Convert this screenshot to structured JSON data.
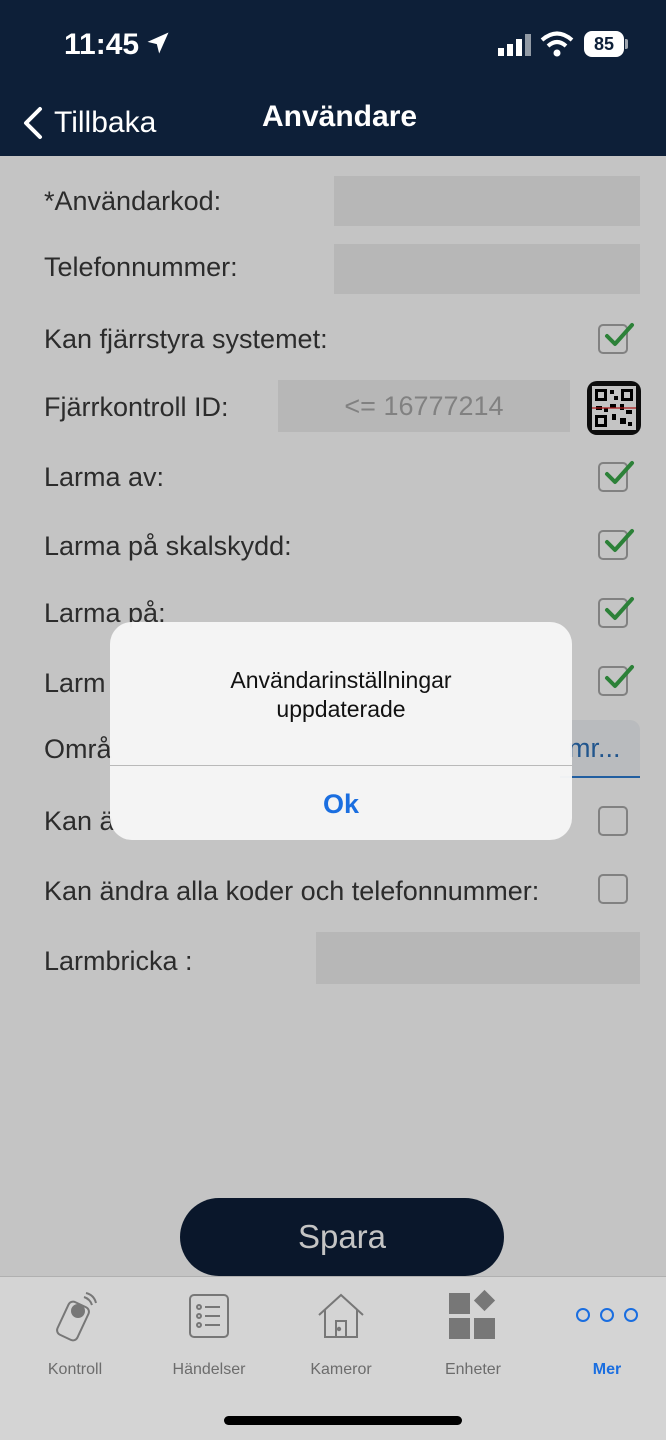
{
  "status_bar": {
    "time": "11:45",
    "battery": "85",
    "location_icon": "location-arrow-icon",
    "signal_icon": "cellular-signal-icon",
    "wifi_icon": "wifi-icon"
  },
  "nav": {
    "back_label": "Tillbaka",
    "title": "Användare"
  },
  "form": {
    "user_code_label": "*Användarkod:",
    "user_code_value": "",
    "phone_label": "Telefonnummer:",
    "phone_value": "",
    "remote_control_label": "Kan fjärrstyra systemet:",
    "remote_control_checked": true,
    "remote_id_label": "Fjärrkontroll ID:",
    "remote_id_placeholder": "<= 16777214",
    "disarm_label": "Larma av:",
    "disarm_checked": true,
    "arm_shell_label": "Larma på skalskydd:",
    "arm_shell_checked": true,
    "arm_label": "Larma på:",
    "arm_checked": true,
    "row4_label_visible": "Larm",
    "row4_checked": true,
    "area_label_visible": "Områ",
    "area_select_visible": "mr...",
    "can_change_visible": "Kan ä",
    "can_change_checked": false,
    "can_change_all_label": "Kan ändra alla koder och telefonnummer:",
    "can_change_all_checked": false,
    "tag_label": "Larmbricka :",
    "tag_value": ""
  },
  "save_button": "Spara",
  "alert": {
    "message_line1": "Användarinställningar",
    "message_line2": "uppdaterade",
    "ok_label": "Ok"
  },
  "tabs": [
    {
      "label": "Kontroll",
      "icon": "remote-control-icon",
      "active": false
    },
    {
      "label": "Händelser",
      "icon": "list-icon",
      "active": false
    },
    {
      "label": "Kameror",
      "icon": "house-icon",
      "active": false
    },
    {
      "label": "Enheter",
      "icon": "devices-icon",
      "active": false
    },
    {
      "label": "Mer",
      "icon": "more-icon",
      "active": true
    }
  ],
  "colors": {
    "navy": "#0d1f38",
    "accent": "#1a6ee0",
    "check_green": "#3aa84a"
  }
}
